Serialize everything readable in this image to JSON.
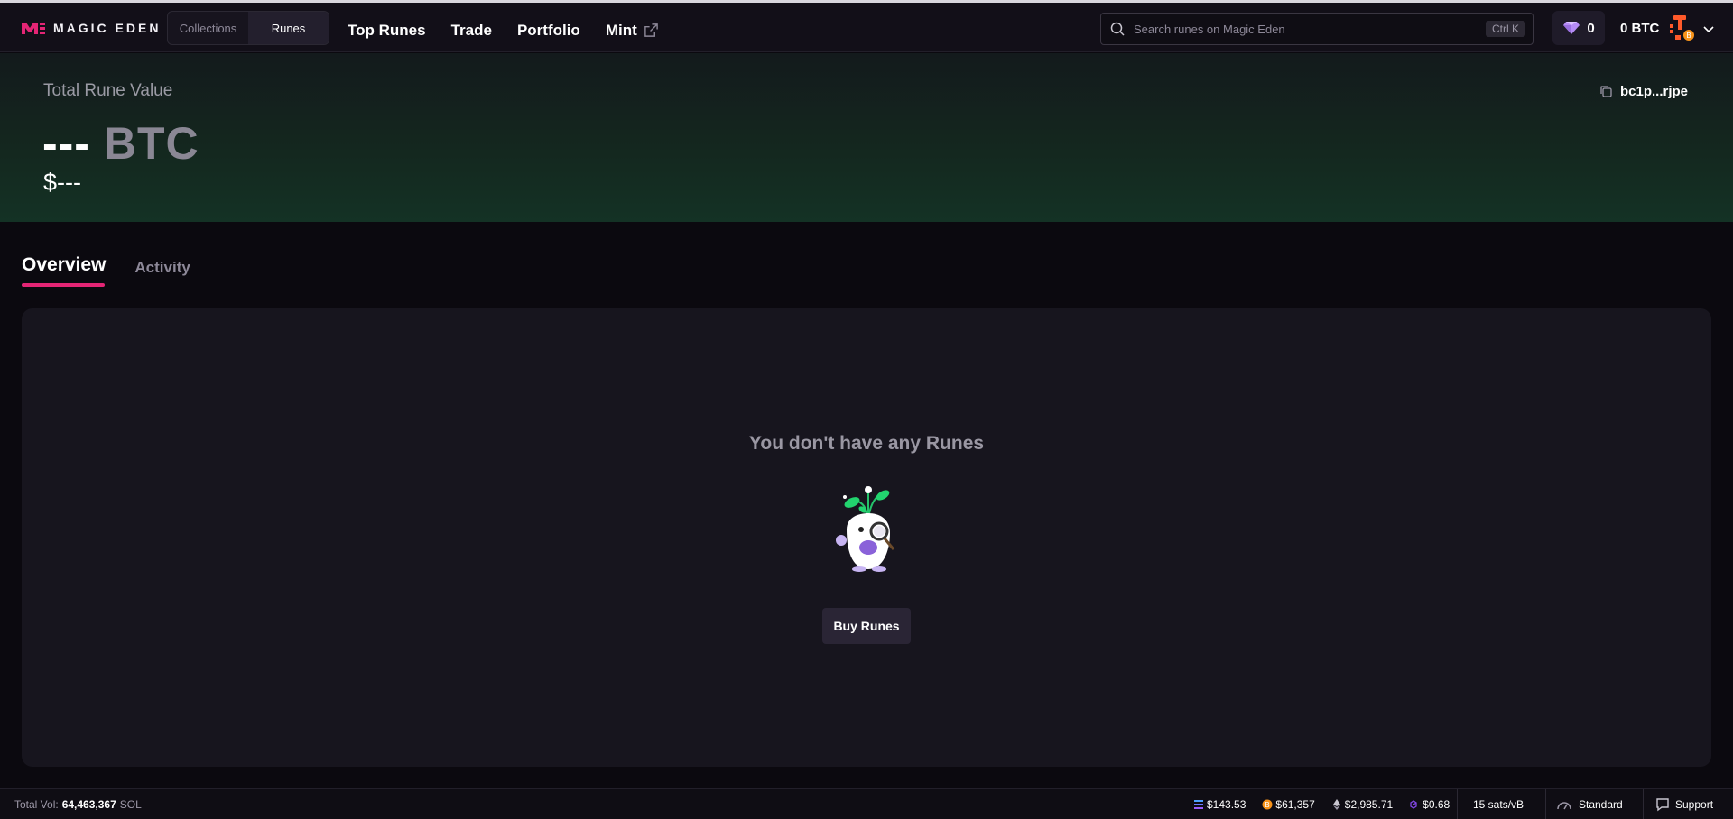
{
  "brand": {
    "logo_text": "MAGIC EDEN",
    "accent": "#e42575"
  },
  "header": {
    "segments": [
      "Collections",
      "Runes"
    ],
    "active_segment": "Runes",
    "nav": [
      "Top Runes",
      "Trade",
      "Portfolio",
      "Mint"
    ],
    "search_placeholder": "Search runes on Magic Eden",
    "shortcut": "Ctrl K",
    "gem_count": "0",
    "btc_balance": "0 BTC"
  },
  "hero": {
    "label": "Total Rune Value",
    "value_dashes": "---",
    "value_unit": "BTC",
    "usd_value": "$---",
    "address": "bc1p...rjpe",
    "gradient_end": "#143225"
  },
  "tabs": [
    "Overview",
    "Activity"
  ],
  "active_tab": "Overview",
  "empty_state": {
    "message": "You don't have any Runes",
    "button": "Buy Runes"
  },
  "footer": {
    "volume_label": "Total Vol:",
    "volume_value": "64,463,367",
    "volume_unit": "SOL",
    "sol_price": "$143.53",
    "btc_price": "$61,357",
    "eth_price": "$2,985.71",
    "matic_price": "$0.68",
    "fee": "15 sats/vB",
    "speed": "Standard",
    "support": "Support"
  },
  "icons": [
    "logo-mark-icon",
    "external-link-icon",
    "search-icon",
    "gem-icon",
    "avatar-icon",
    "chevron-down-icon",
    "copy-icon",
    "solana-icon",
    "bitcoin-icon",
    "ethereum-icon",
    "polygon-icon",
    "gauge-icon",
    "chat-icon"
  ]
}
